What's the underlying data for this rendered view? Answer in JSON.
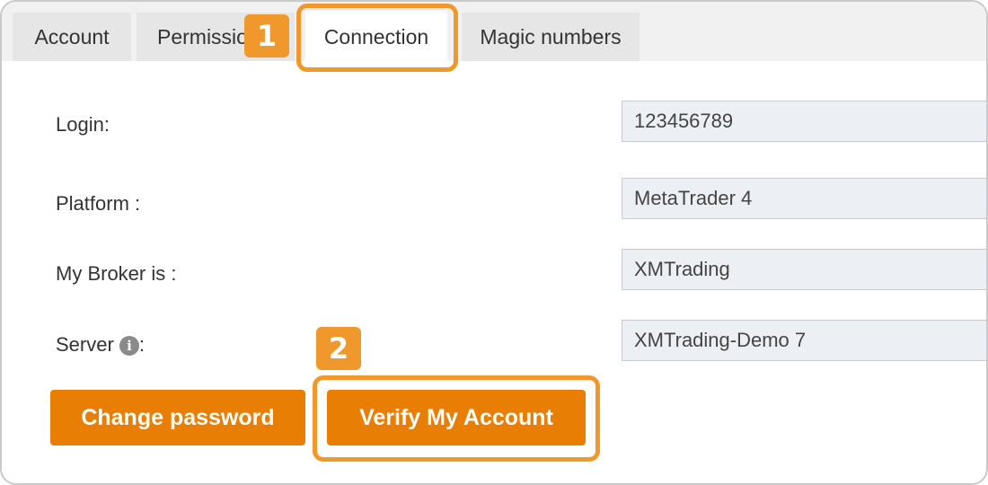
{
  "tabs": {
    "account": "Account",
    "permissions": "Permissions",
    "connection": "Connection",
    "magic_numbers": "Magic numbers",
    "active": "Connection"
  },
  "form": {
    "login": {
      "label": "Login:",
      "value": "123456789"
    },
    "platform": {
      "label": "Platform :",
      "value": "MetaTrader 4"
    },
    "broker": {
      "label": "My Broker is :",
      "value": "XMTrading"
    },
    "server": {
      "label": "Server",
      "label_suffix": ":",
      "info_glyph": "i",
      "value": "XMTrading-Demo 7"
    }
  },
  "buttons": {
    "change_password": "Change password",
    "verify_account": "Verify My Account"
  },
  "callouts": {
    "step1": "1",
    "step2": "2"
  },
  "colors": {
    "button_orange": "#e87e04",
    "callout_orange": "#f0982b",
    "field_bg": "#ecf0f5"
  }
}
